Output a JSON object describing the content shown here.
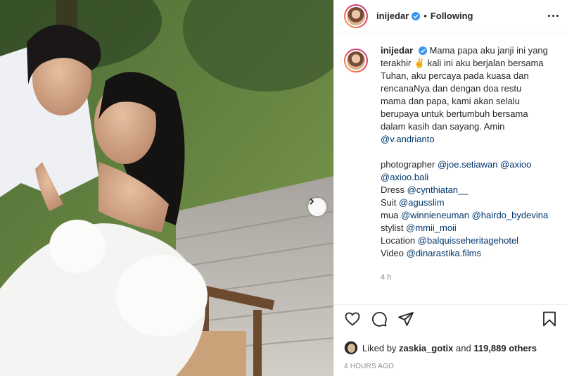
{
  "post": {
    "username": "inijedar",
    "follow_status": "Following",
    "caption": {
      "username": "inijedar",
      "line1": "Mama papa aku janji ini yang",
      "line2": "terakhir ✌ kali ini aku berjalan bersama",
      "line3": "Tuhan, aku percaya pada kuasa dan",
      "line4": "rencanaNya dan dengan doa restu",
      "line5": "mama dan papa, kami akan selalu",
      "line6": "berupaya untuk bertumbuh bersama",
      "line7": "dalam kasih dan sayang. Amin",
      "mention_main": "@v.andrianto",
      "credits": {
        "photographer_label": "photographer",
        "photographer_1": "@joe.setiawan",
        "photographer_2": "@axioo",
        "photographer_3": "@axioo.bali",
        "dress_label": "Dress",
        "dress": "@cynthiatan__",
        "suit_label": "Suit",
        "suit": "@agusslim",
        "mua_label": "mua",
        "mua_1": "@winnieneuman",
        "mua_2": "@hairdo_bydevina",
        "stylist_label": "stylist",
        "stylist": "@mmii_moii",
        "location_label": "Location",
        "location": "@balquisseheritagehotel",
        "video_label": "Video",
        "video": "@dinarastika.films"
      },
      "time_ago": "4 h"
    },
    "likes": {
      "prefix": "Liked by",
      "first_user": "zaskia_gotix",
      "and": "and",
      "others": "119,889 others"
    },
    "timestamp": "4 HOURS AGO"
  },
  "icons": {
    "more": "more-options-icon",
    "verified": "verified-badge-icon",
    "next": "chevron-right-icon",
    "like": "heart-icon",
    "comment": "comment-icon",
    "share": "paper-plane-icon",
    "save": "bookmark-icon"
  },
  "colors": {
    "text": "#262626",
    "muted": "#8e8e8e",
    "mention": "#00376b",
    "verified": "#3897f0"
  }
}
